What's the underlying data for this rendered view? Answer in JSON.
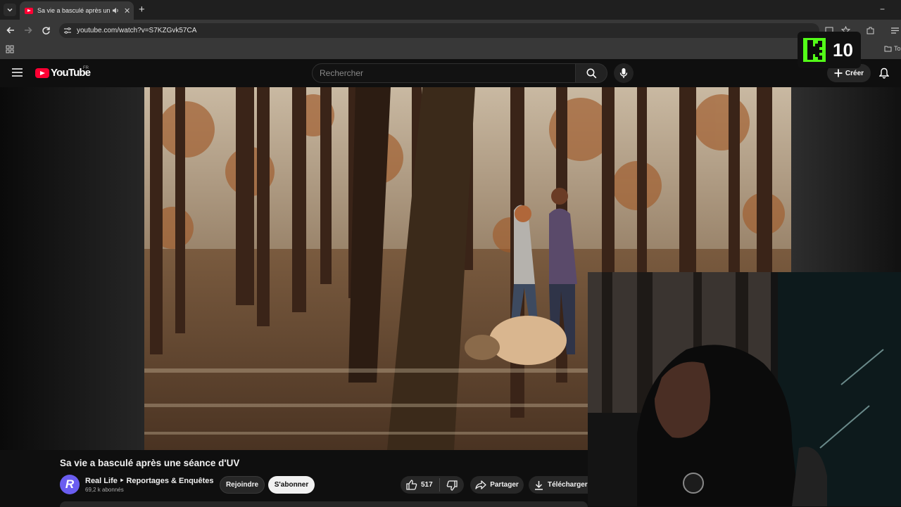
{
  "browser": {
    "tab": {
      "title": "Sa vie a basculé après une séance d'UV"
    },
    "new_tab": "+",
    "minimize": "−",
    "url": "youtube.com/watch?v=S7KZGvk57CA",
    "bookmark_folder": "To"
  },
  "youtube": {
    "logo_text": "YouTube",
    "country_code": "FR",
    "search": {
      "placeholder": "Rechercher"
    },
    "create_label": "Créer"
  },
  "overlay": {
    "k_count": "10"
  },
  "video": {
    "title": "Sa vie a basculé après une séance d'UV",
    "channel": {
      "avatar_letter": "R",
      "name": "Real Life ‣ Reportages & Enquêtes",
      "subscribers": "69,2 k abonnés"
    },
    "join_label": "Rejoindre",
    "subscribe_label": "S'abonner",
    "likes": "517",
    "share_label": "Partager",
    "download_label": "Télécharger"
  }
}
